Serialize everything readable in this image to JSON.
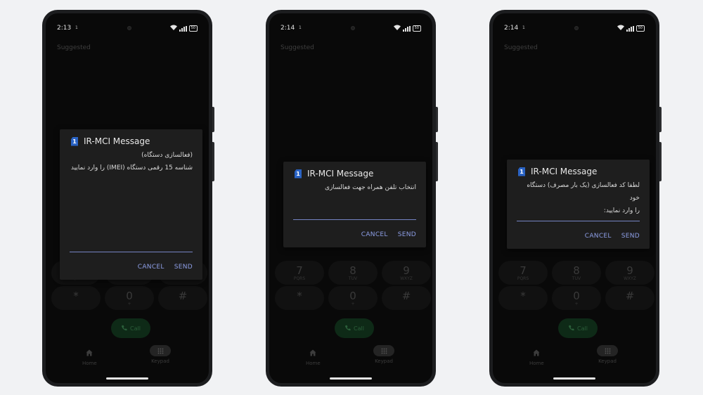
{
  "status": {
    "battery": "50",
    "sim_slot": "1"
  },
  "phones": [
    {
      "time": "2:13"
    },
    {
      "time": "2:14"
    },
    {
      "time": "2:14"
    }
  ],
  "suggested_label": "Suggested",
  "keypad": {
    "keys": [
      {
        "digit": "7",
        "letters": "PQRS"
      },
      {
        "digit": "8",
        "letters": "TUV"
      },
      {
        "digit": "9",
        "letters": "WXYZ"
      },
      {
        "digit": "*",
        "letters": ""
      },
      {
        "digit": "0",
        "letters": "+"
      },
      {
        "digit": "#",
        "letters": ""
      }
    ],
    "call_label": "Call"
  },
  "nav": {
    "home_label": "Home",
    "keypad_label": "Keypad"
  },
  "dialogs": [
    {
      "title": "IR-MCI Message",
      "message_lines": [
        "(فعالسازی دستگاه)",
        "شناسه 15 رقمی دستگاه (IMEI) را وارد نمایید"
      ],
      "input_value": "",
      "cancel_label": "CANCEL",
      "send_label": "SEND"
    },
    {
      "title": "IR-MCI Message",
      "message_lines": [
        "انتخاب تلفن همراه جهت فعالسازی"
      ],
      "input_value": "",
      "cancel_label": "CANCEL",
      "send_label": "SEND"
    },
    {
      "title": "IR-MCI Message",
      "message_lines": [
        "لطفا کد فعالسازی (یک بار مصرف) دستگاه خود",
        "را وارد نمایید:"
      ],
      "input_value": "",
      "cancel_label": "CANCEL",
      "send_label": "SEND"
    }
  ],
  "colors": {
    "accent": "#8d9ee6",
    "sim_icon": "#2a63c4",
    "dialog_bg": "#1e1e1e"
  }
}
